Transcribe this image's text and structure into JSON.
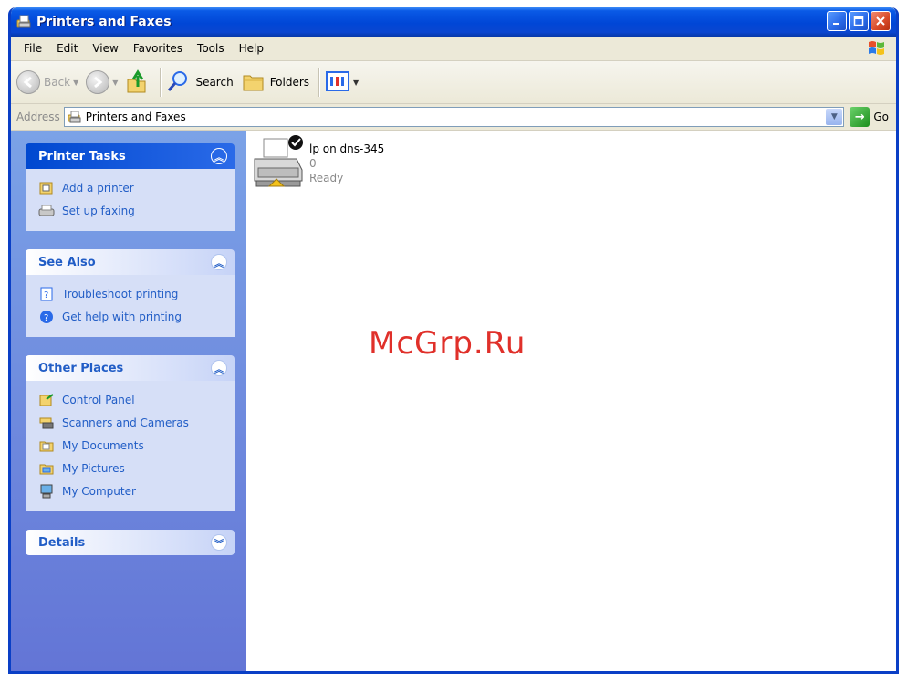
{
  "window": {
    "title": "Printers and Faxes"
  },
  "title_buttons": {
    "minimize": "_",
    "maximize": "□",
    "close": "✕"
  },
  "menu": [
    "File",
    "Edit",
    "View",
    "Favorites",
    "Tools",
    "Help"
  ],
  "toolbar": {
    "back": "Back",
    "search": "Search",
    "folders": "Folders"
  },
  "address": {
    "label": "Address",
    "value": "Printers and Faxes",
    "go": "Go"
  },
  "sidebar": {
    "printer_tasks": {
      "title": "Printer Tasks",
      "items": [
        "Add a printer",
        "Set up faxing"
      ]
    },
    "see_also": {
      "title": "See Also",
      "items": [
        "Troubleshoot printing",
        "Get help with printing"
      ]
    },
    "other_places": {
      "title": "Other Places",
      "items": [
        "Control Panel",
        "Scanners and Cameras",
        "My Documents",
        "My Pictures",
        "My Computer"
      ]
    },
    "details": {
      "title": "Details"
    }
  },
  "printer": {
    "name": "lp on dns-345",
    "jobs": "0",
    "status": "Ready"
  },
  "watermark": "McGrp.Ru",
  "colors": {
    "title_blue": "#0a46d0",
    "sidebar_top": "#7ba2e7",
    "sidebar_bottom": "#6375d6",
    "link_blue": "#215dc6",
    "watermark_red": "#e0302a"
  }
}
